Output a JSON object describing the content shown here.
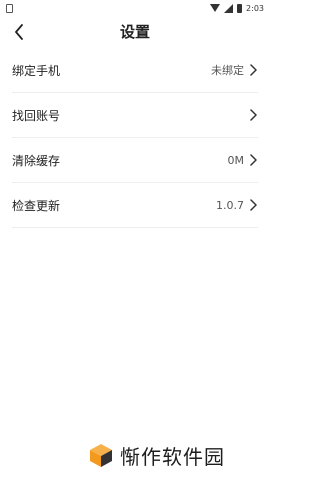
{
  "status_bar": {
    "time": "2:03"
  },
  "header": {
    "title": "设置"
  },
  "settings": [
    {
      "label": "绑定手机",
      "value": "未绑定"
    },
    {
      "label": "找回账号",
      "value": ""
    },
    {
      "label": "清除缓存",
      "value": "0M"
    },
    {
      "label": "检查更新",
      "value": "1.0.7"
    }
  ],
  "watermark": {
    "text": "惭作软件园",
    "logo_colors": [
      "#f39a1e",
      "#333333"
    ]
  }
}
